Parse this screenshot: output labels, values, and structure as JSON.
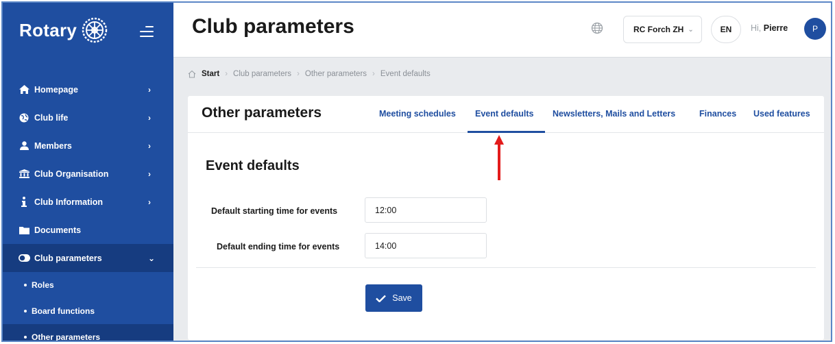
{
  "sidebar": {
    "logo_text": "Rotary",
    "items": [
      {
        "label": "Homepage",
        "icon": "home-icon",
        "chevron": "›"
      },
      {
        "label": "Club life",
        "icon": "globe-icon",
        "chevron": "›"
      },
      {
        "label": "Members",
        "icon": "user-icon",
        "chevron": "›"
      },
      {
        "label": "Club Organisation",
        "icon": "institution-icon",
        "chevron": "›"
      },
      {
        "label": "Club Information",
        "icon": "info-icon",
        "chevron": "›"
      },
      {
        "label": "Documents",
        "icon": "folder-icon",
        "chevron": ""
      },
      {
        "label": "Club parameters",
        "icon": "toggle-icon",
        "chevron": "⌄"
      }
    ],
    "sub_items": [
      {
        "label": "Roles"
      },
      {
        "label": "Board functions"
      },
      {
        "label": "Other parameters"
      }
    ]
  },
  "header": {
    "title": "Club parameters",
    "club_select": "RC Forch ZH",
    "language": "EN",
    "greeting_prefix": "Hi,",
    "user_name": "Pierre",
    "avatar_initial": "P"
  },
  "breadcrumb": [
    "Start",
    "Club parameters",
    "Other parameters",
    "Event defaults"
  ],
  "card": {
    "title": "Other parameters",
    "tabs": [
      {
        "label": "Meeting schedules"
      },
      {
        "label": "Event defaults"
      },
      {
        "label": "Newsletters, Mails and Letters"
      },
      {
        "label": "Finances"
      },
      {
        "label": "Used features"
      }
    ],
    "active_tab": "Event defaults"
  },
  "form": {
    "section_title": "Event defaults",
    "start_label": "Default starting time for events",
    "start_value": "12:00",
    "end_label": "Default ending time for events",
    "end_value": "14:00",
    "save_label": "Save"
  },
  "colors": {
    "brand_blue": "#1f4ea0",
    "sidebar_active": "#163c80",
    "annotation_arrow": "#e31b1b"
  }
}
